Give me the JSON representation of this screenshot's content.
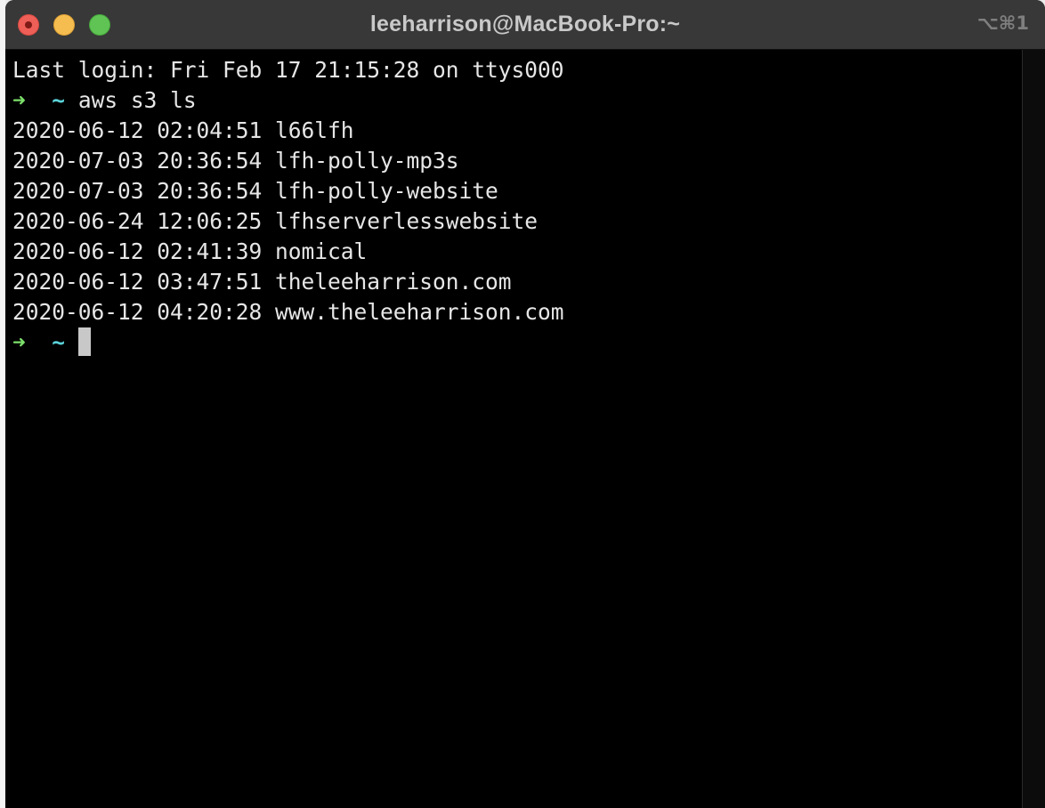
{
  "window": {
    "title": "leeharrison@MacBook-Pro:~",
    "shortcut": "⌥⌘1"
  },
  "terminal": {
    "last_login": "Last login: Fri Feb 17 21:15:28 on ttys000",
    "prompt_arrow": "➜",
    "prompt_dir": "~",
    "command": "aws s3 ls",
    "output": [
      "2020-06-12 02:04:51 l66lfh",
      "2020-07-03 20:36:54 lfh-polly-mp3s",
      "2020-07-03 20:36:54 lfh-polly-website",
      "2020-06-24 12:06:25 lfhserverlesswebsite",
      "2020-06-12 02:41:39 nomical",
      "2020-06-12 03:47:51 theleeharrison.com",
      "2020-06-12 04:20:28 www.theleeharrison.com"
    ]
  },
  "colors": {
    "prompt_arrow": "#7ce06a",
    "prompt_dir": "#5ad2d8",
    "text": "#e6e6e6",
    "background": "#000000"
  }
}
